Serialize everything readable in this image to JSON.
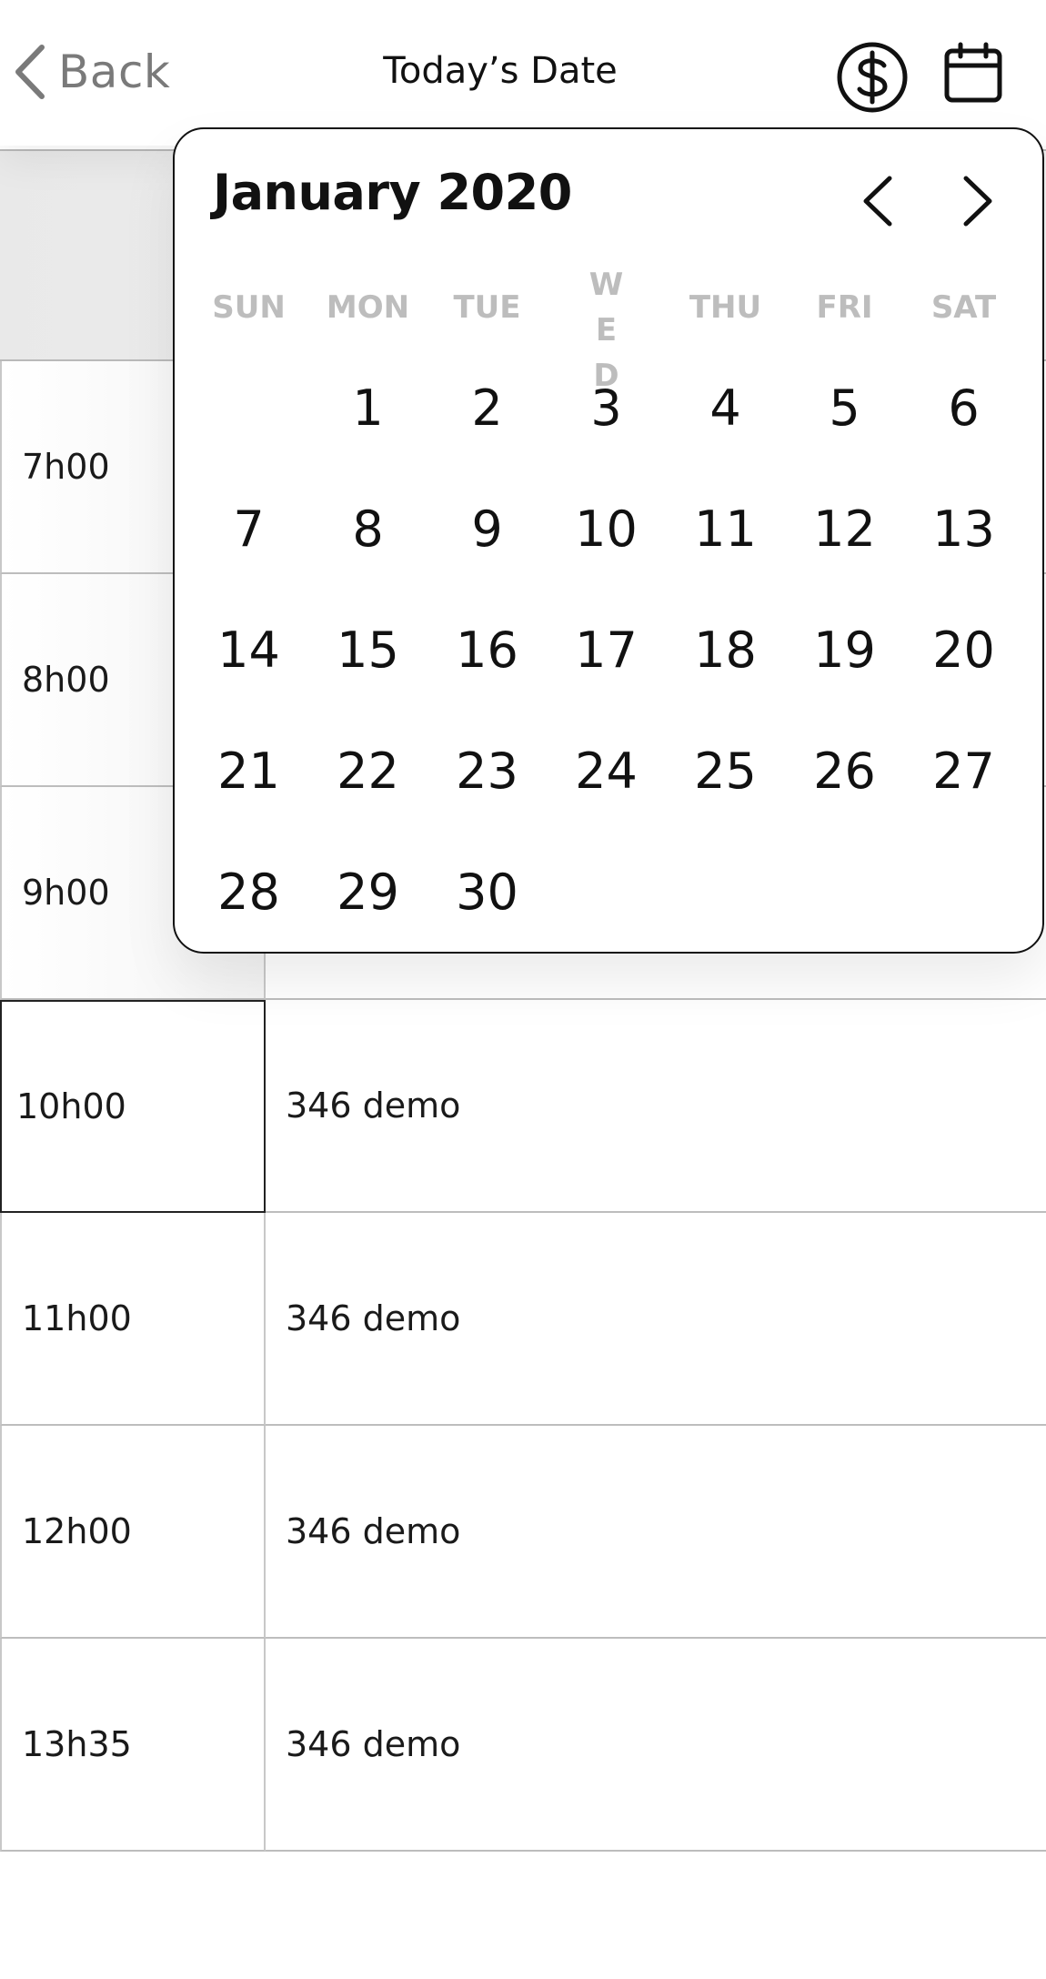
{
  "header": {
    "back_label": "Back",
    "title": "Today’s Date",
    "icons": {
      "back": "chevron-left-icon",
      "money": "dollar-circle-icon",
      "calendar": "calendar-icon"
    }
  },
  "schedule": {
    "rows": [
      {
        "time": "7h00",
        "event": ""
      },
      {
        "time": "8h00",
        "event": ""
      },
      {
        "time": "9h00",
        "event": ""
      },
      {
        "time": "10h00",
        "event": "346 demo"
      },
      {
        "time": "11h00",
        "event": "346 demo"
      },
      {
        "time": "12h00",
        "event": "346 demo"
      },
      {
        "time": "13h35",
        "event": "346 demo"
      }
    ]
  },
  "calendar": {
    "month_label": "January 2020",
    "weekdays": [
      "SUN",
      "MON",
      "TUE",
      "WED",
      "THU",
      "FRI",
      "SAT"
    ],
    "weeks": [
      [
        "",
        "1",
        "2",
        "3",
        "4",
        "5",
        "6"
      ],
      [
        "7",
        "8",
        "9",
        "10",
        "11",
        "12",
        "13"
      ],
      [
        "14",
        "15",
        "16",
        "17",
        "18",
        "19",
        "20"
      ],
      [
        "21",
        "22",
        "23",
        "24",
        "25",
        "26",
        "27"
      ],
      [
        "28",
        "29",
        "30",
        "",
        "",
        "",
        ""
      ]
    ],
    "icons": {
      "prev": "chevron-left-icon",
      "next": "chevron-right-icon"
    }
  },
  "colors": {
    "text": "#111111",
    "muted": "#7a7a7a",
    "weekday": "#bdbdbd",
    "grid_line": "#bdbdbd"
  }
}
